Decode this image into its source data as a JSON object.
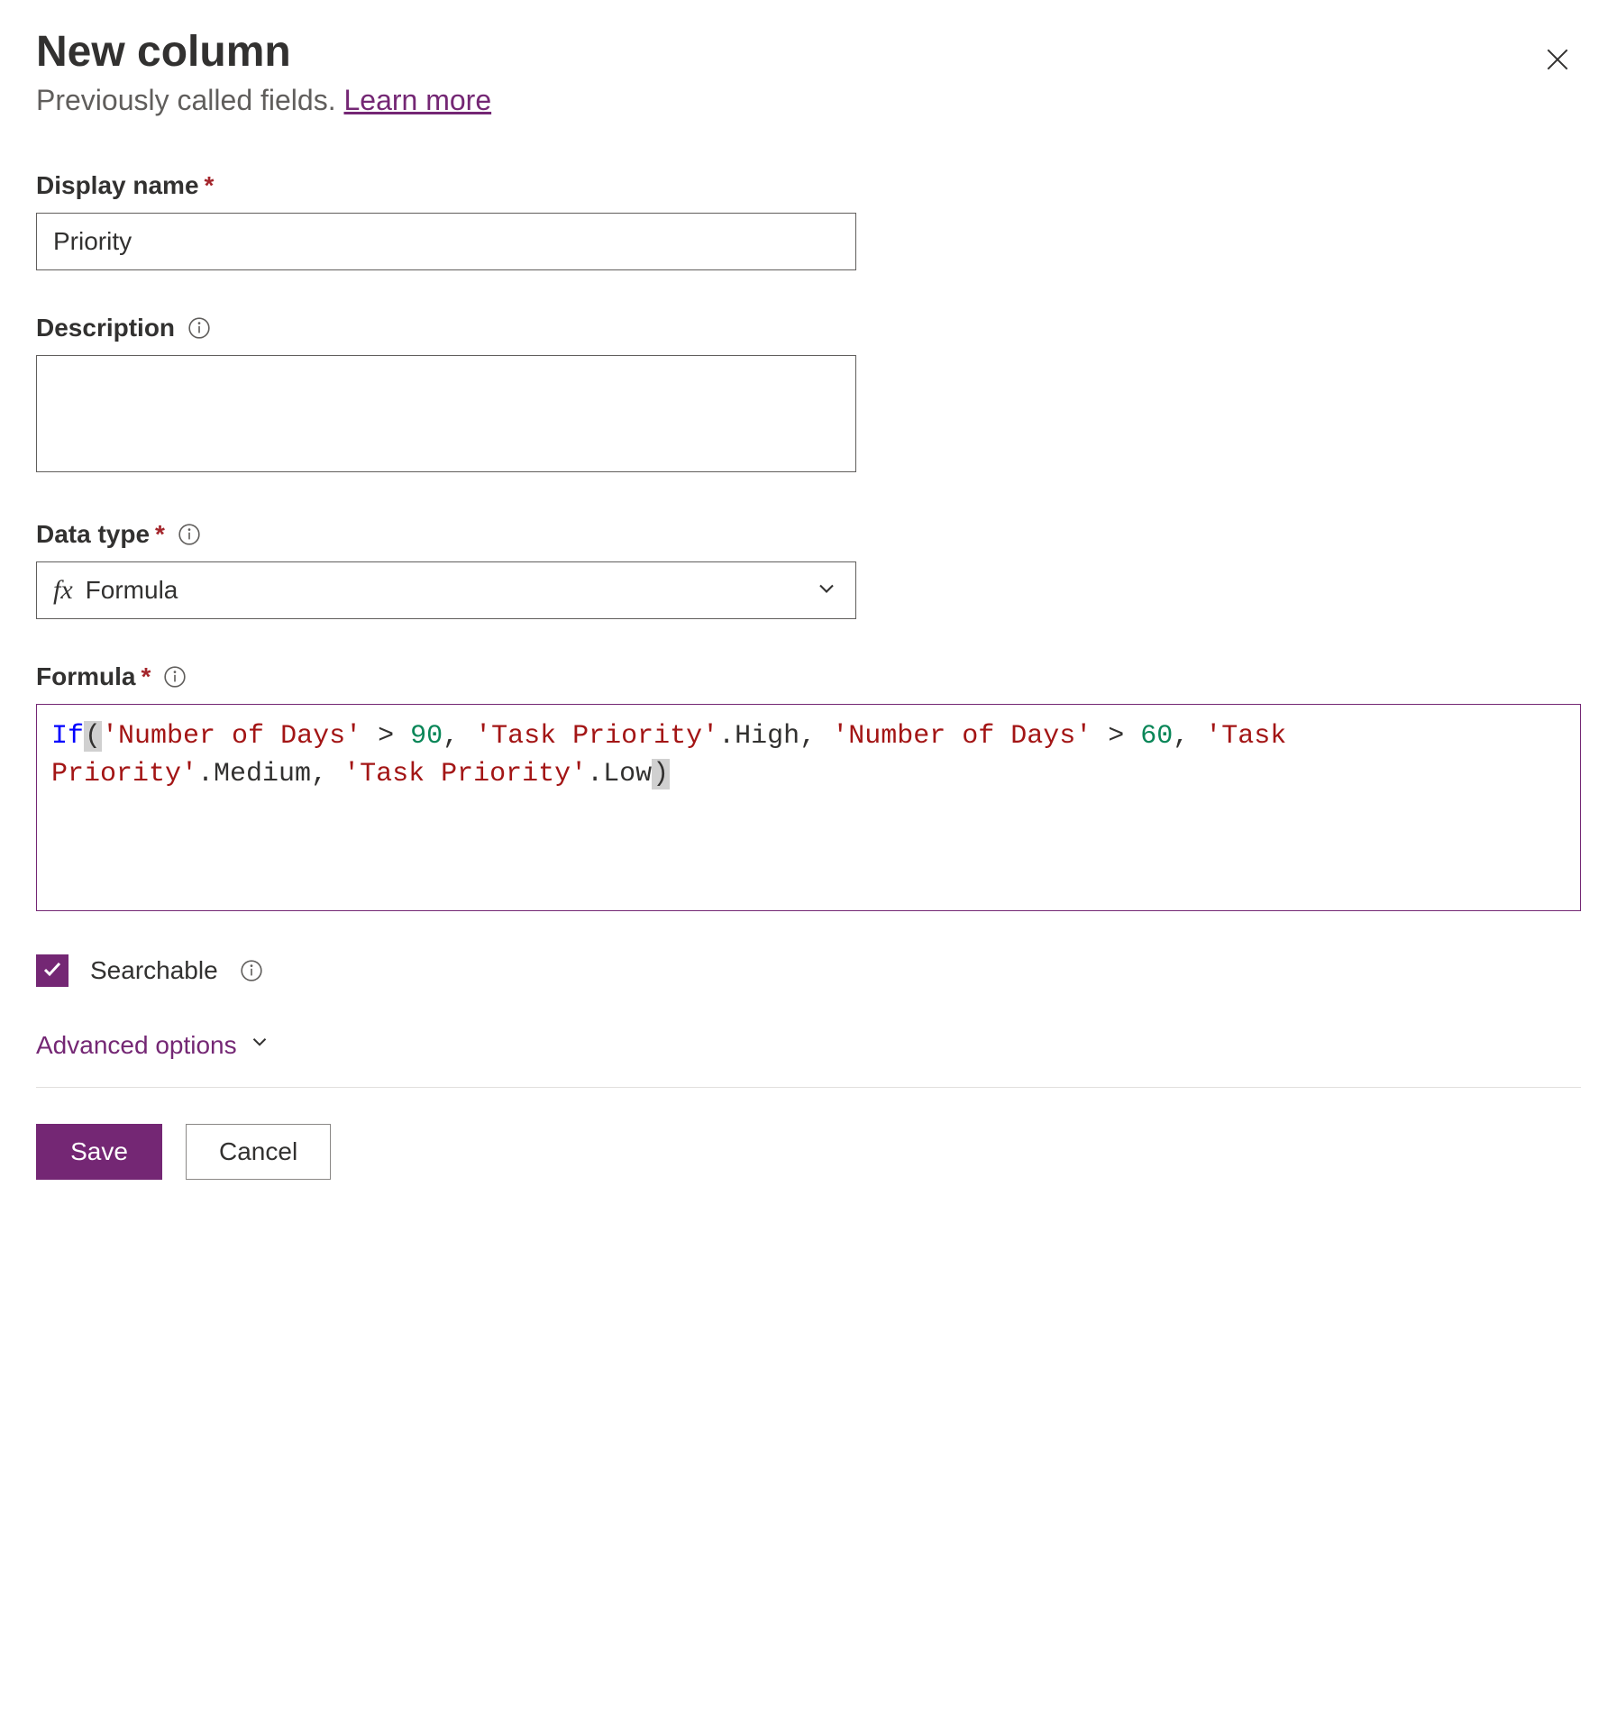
{
  "header": {
    "title": "New column",
    "subtitle_prefix": "Previously called fields. ",
    "learn_more": "Learn more"
  },
  "fields": {
    "display_name": {
      "label": "Display name",
      "value": "Priority"
    },
    "description": {
      "label": "Description",
      "value": ""
    },
    "data_type": {
      "label": "Data type",
      "selected": "Formula"
    },
    "formula": {
      "label": "Formula",
      "tokens": [
        {
          "t": "fn",
          "v": "If"
        },
        {
          "t": "paren_h",
          "v": "("
        },
        {
          "t": "str",
          "v": "'Number of Days'"
        },
        {
          "t": "plain",
          "v": " > "
        },
        {
          "t": "num",
          "v": "90"
        },
        {
          "t": "punct",
          "v": ", "
        },
        {
          "t": "str",
          "v": "'Task Priority'"
        },
        {
          "t": "plain",
          "v": ".High"
        },
        {
          "t": "punct",
          "v": ", "
        },
        {
          "t": "str",
          "v": "'Number of Days'"
        },
        {
          "t": "plain",
          "v": " > "
        },
        {
          "t": "num",
          "v": "60"
        },
        {
          "t": "punct",
          "v": ", "
        },
        {
          "t": "str",
          "v": "'Task Priority'"
        },
        {
          "t": "plain",
          "v": ".Medium"
        },
        {
          "t": "punct",
          "v": ", "
        },
        {
          "t": "str",
          "v": "'Task Priority'"
        },
        {
          "t": "plain",
          "v": ".Low"
        },
        {
          "t": "paren_h",
          "v": ")"
        }
      ]
    }
  },
  "searchable": {
    "label": "Searchable",
    "checked": true
  },
  "advanced": {
    "label": "Advanced options"
  },
  "buttons": {
    "save": "Save",
    "cancel": "Cancel"
  }
}
